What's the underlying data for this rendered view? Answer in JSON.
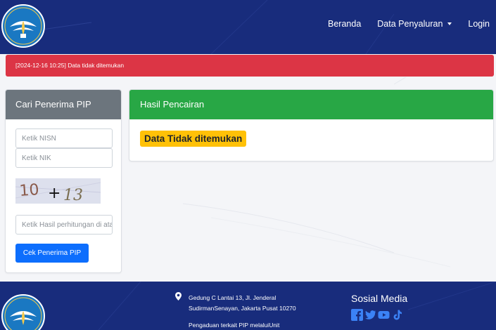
{
  "nav": {
    "items": [
      {
        "label": "Beranda"
      },
      {
        "label": "Data Penyaluran"
      },
      {
        "label": "Login"
      }
    ]
  },
  "alert": {
    "message": "[2024-12-16 10:25] Data tidak ditemukan"
  },
  "search": {
    "title": "Cari Penerima PIP",
    "nisn_placeholder": "Ketik NISN",
    "nik_placeholder": "Ketik NIK",
    "captcha_left": "10",
    "captcha_op": "+",
    "captcha_right": "13",
    "answer_placeholder": "Ketik Hasil perhitungan di atas",
    "submit_label": "Cek Penerima PIP"
  },
  "result": {
    "title": "Hasil Pencairan",
    "status_badge": "Data Tidak ditemukan"
  },
  "footer": {
    "address_line1": "Gedung C Lantai 13, Jl. Jenderal",
    "address_line2": "SudirmanSenayan, Jakarta Pusat 10270",
    "complaint_text": "Pengaduan terkait PIP melaluiUnit",
    "social_title": "Sosial Media",
    "social_icons": [
      "facebook-icon",
      "twitter-icon",
      "youtube-icon",
      "tiktok-icon"
    ]
  },
  "colors": {
    "navbar": "#182c7c",
    "alert": "#dc3545",
    "search_header": "#6c757d",
    "result_header": "#28a745",
    "badge": "#ffc107",
    "button": "#0d6efd",
    "social_icons": "#3b82f6"
  }
}
